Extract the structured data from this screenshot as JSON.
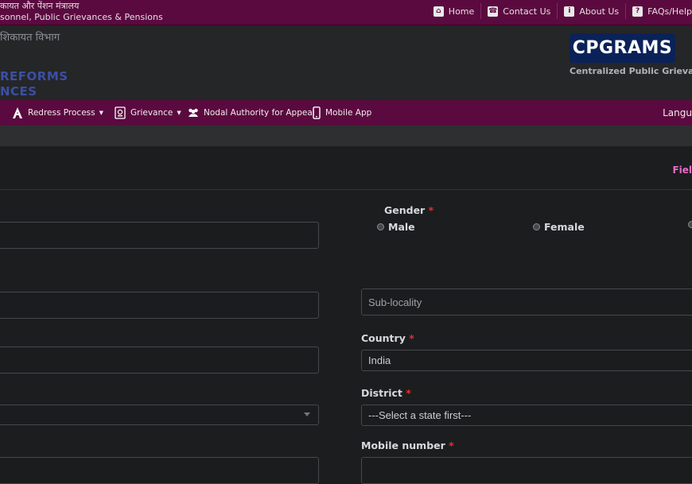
{
  "topbar": {
    "line1": "कायत और पेंशन मंत्रालय",
    "line2": "sonnel, Public Grievances & Pensions",
    "links": [
      {
        "label": "Home",
        "icon": "home-icon"
      },
      {
        "label": "Contact Us",
        "icon": "phone-icon"
      },
      {
        "label": "About Us",
        "icon": "info-icon"
      },
      {
        "label": "FAQs/Help",
        "icon": "question-icon"
      }
    ]
  },
  "header": {
    "hindi_dept": "शिकायत विभाग",
    "reforms_line1": "REFORMS",
    "reforms_line2": "NCES",
    "logo_text": "CPGRAMS",
    "logo_subtitle": "Centralized Public Grievar"
  },
  "nav": {
    "items": [
      {
        "label": "Redress Process",
        "icon": "redress-icon",
        "dropdown": true
      },
      {
        "label": "Grievance",
        "icon": "grievance-icon",
        "dropdown": true
      },
      {
        "label": "Nodal Authority for Appeal",
        "icon": "users-icon",
        "dropdown": false
      },
      {
        "label": "Mobile App",
        "icon": "mobile-icon",
        "dropdown": false
      }
    ],
    "language_label": "Langu"
  },
  "form": {
    "fields_mandatory": "Fiel",
    "gender_label": "Gender",
    "gender_options": [
      "Male",
      "Female"
    ],
    "sublocality_placeholder": "Sub-locality",
    "country_label": "Country",
    "country_value": "India",
    "district_label": "District",
    "district_value": "---Select a state first---",
    "mobile_label": "Mobile number",
    "required_mark": "*"
  },
  "colors": {
    "brand_purple": "#5a0a3f",
    "logo_navy": "#0b2258",
    "mandatory_pink": "#e86bc6",
    "required_red": "#e0322f"
  }
}
